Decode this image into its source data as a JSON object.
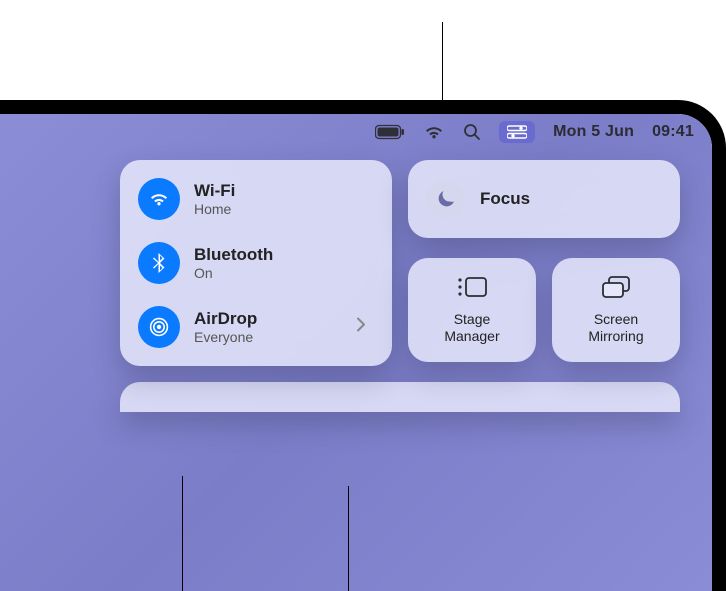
{
  "menubar": {
    "date": "Mon 5 Jun",
    "time": "09:41",
    "battery_icon": "battery-full",
    "wifi_icon": "wifi",
    "search_icon": "search",
    "control_center_icon": "control-center"
  },
  "control_center": {
    "connectivity": {
      "wifi": {
        "label": "Wi-Fi",
        "status": "Home",
        "on": true
      },
      "bluetooth": {
        "label": "Bluetooth",
        "status": "On",
        "on": true
      },
      "airdrop": {
        "label": "AirDrop",
        "status": "Everyone",
        "on": true
      }
    },
    "focus": {
      "label": "Focus"
    },
    "stage_manager": {
      "label": "Stage\nManager"
    },
    "screen_mirroring": {
      "label": "Screen\nMirroring"
    }
  },
  "colors": {
    "accent": "#0a7aff",
    "highlight": "#6a6bcf"
  }
}
